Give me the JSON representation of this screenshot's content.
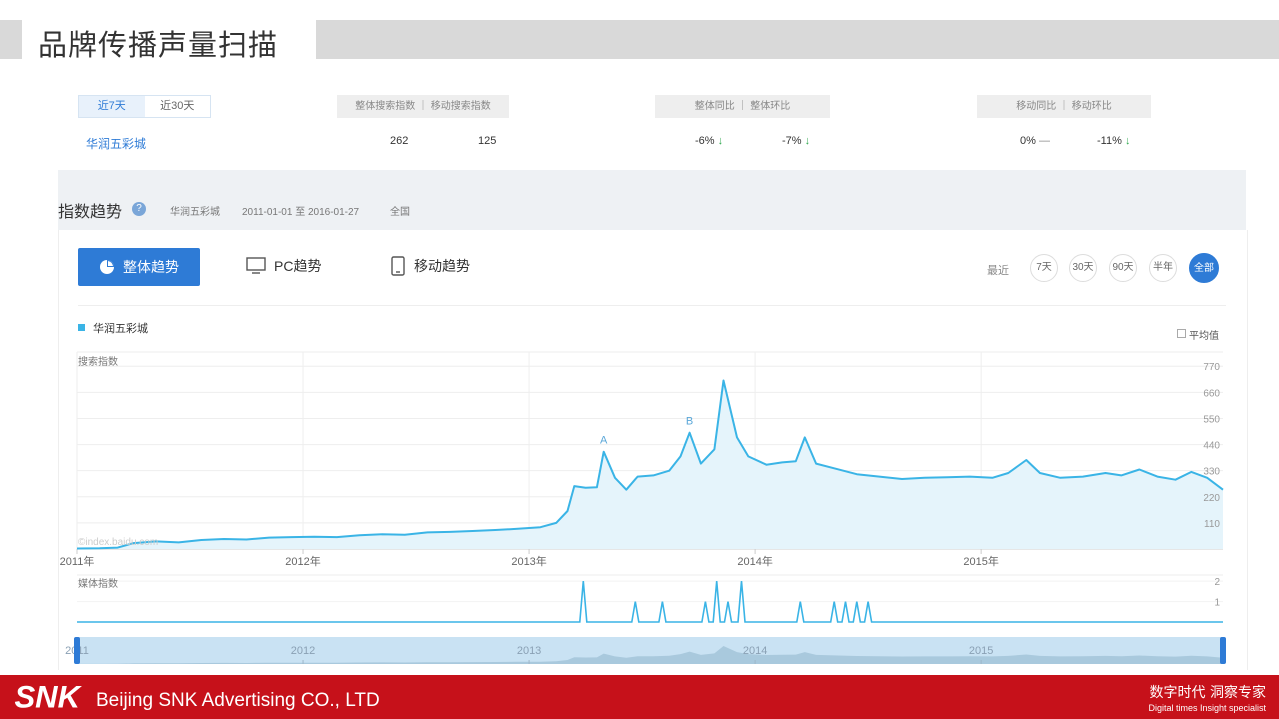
{
  "slide": {
    "title": "品牌传播声量扫描"
  },
  "summary": {
    "tabs": [
      {
        "label": "近7天",
        "active": true
      },
      {
        "label": "近30天",
        "active": false
      }
    ],
    "groups": [
      {
        "header": "整体搜索指数 ｜ 移动搜索指数"
      },
      {
        "header": "整体同比 ｜ 整体环比"
      },
      {
        "header": "移动同比 ｜ 移动环比"
      }
    ],
    "brand": "华润五彩城",
    "values": {
      "overall_search": "262",
      "mobile_search": "125",
      "overall_yoy": "-6%",
      "overall_mom": "-7%",
      "mobile_yoy": "0%",
      "mobile_yoy_flat": "—",
      "mobile_mom": "-11%"
    },
    "arrow_down": "↓"
  },
  "index_trend": {
    "title": "指数趋势",
    "help": "?",
    "brand": "华润五彩城",
    "date_range": "2011-01-01 至 2016-01-27",
    "region": "全国"
  },
  "view_tabs": {
    "overall": "整体趋势",
    "pc": "PC趋势",
    "mobile": "移动趋势"
  },
  "range": {
    "label": "最近",
    "options": [
      {
        "label": "7天",
        "active": false
      },
      {
        "label": "30天",
        "active": false
      },
      {
        "label": "90天",
        "active": false
      },
      {
        "label": "半年",
        "active": false
      },
      {
        "label": "全部",
        "active": true
      }
    ]
  },
  "legend": {
    "series": "华润五彩城",
    "average": "平均值"
  },
  "chart_data": [
    {
      "type": "area",
      "ylabel": "搜索指数",
      "yticks": [
        110,
        220,
        330,
        440,
        550,
        660,
        770
      ],
      "ylim": [
        0,
        830
      ],
      "x_ticks": [
        "2011年",
        "2012年",
        "2013年",
        "2014年",
        "2015年"
      ],
      "xlim": [
        2011.0,
        2016.07
      ],
      "watermark": "©index.baidu.com",
      "color": "#3ab4e6",
      "fill": "#e5f4fb",
      "annotations": [
        {
          "label": "A",
          "x": 2013.33
        },
        {
          "label": "B",
          "x": 2013.71
        }
      ],
      "series": [
        {
          "name": "华润五彩城",
          "points": [
            [
              2011.0,
              2
            ],
            [
              2011.1,
              3
            ],
            [
              2011.18,
              6
            ],
            [
              2011.25,
              25
            ],
            [
              2011.35,
              32
            ],
            [
              2011.45,
              28
            ],
            [
              2011.55,
              38
            ],
            [
              2011.65,
              42
            ],
            [
              2011.75,
              40
            ],
            [
              2011.85,
              48
            ],
            [
              2011.95,
              50
            ],
            [
              2012.05,
              52
            ],
            [
              2012.15,
              50
            ],
            [
              2012.25,
              58
            ],
            [
              2012.35,
              62
            ],
            [
              2012.45,
              60
            ],
            [
              2012.55,
              70
            ],
            [
              2012.65,
              72
            ],
            [
              2012.75,
              76
            ],
            [
              2012.85,
              80
            ],
            [
              2012.95,
              85
            ],
            [
              2013.05,
              92
            ],
            [
              2013.12,
              110
            ],
            [
              2013.17,
              160
            ],
            [
              2013.2,
              265
            ],
            [
              2013.25,
              258
            ],
            [
              2013.3,
              260
            ],
            [
              2013.33,
              410
            ],
            [
              2013.38,
              300
            ],
            [
              2013.43,
              250
            ],
            [
              2013.48,
              305
            ],
            [
              2013.55,
              310
            ],
            [
              2013.62,
              330
            ],
            [
              2013.67,
              390
            ],
            [
              2013.71,
              490
            ],
            [
              2013.76,
              360
            ],
            [
              2013.82,
              420
            ],
            [
              2013.86,
              710
            ],
            [
              2013.92,
              470
            ],
            [
              2013.97,
              390
            ],
            [
              2014.05,
              355
            ],
            [
              2014.12,
              365
            ],
            [
              2014.18,
              370
            ],
            [
              2014.22,
              470
            ],
            [
              2014.27,
              360
            ],
            [
              2014.35,
              340
            ],
            [
              2014.45,
              315
            ],
            [
              2014.55,
              305
            ],
            [
              2014.65,
              295
            ],
            [
              2014.75,
              300
            ],
            [
              2014.85,
              302
            ],
            [
              2014.95,
              305
            ],
            [
              2015.05,
              300
            ],
            [
              2015.12,
              320
            ],
            [
              2015.2,
              375
            ],
            [
              2015.26,
              320
            ],
            [
              2015.35,
              300
            ],
            [
              2015.45,
              305
            ],
            [
              2015.55,
              320
            ],
            [
              2015.62,
              310
            ],
            [
              2015.7,
              335
            ],
            [
              2015.78,
              305
            ],
            [
              2015.86,
              292
            ],
            [
              2015.93,
              325
            ],
            [
              2016.0,
              300
            ],
            [
              2016.07,
              250
            ]
          ]
        }
      ]
    },
    {
      "type": "line",
      "ylabel": "媒体指数",
      "yticks": [
        1,
        2
      ],
      "ylim": [
        0,
        2.3
      ],
      "color": "#3ab4e6",
      "series": [
        {
          "name": "华润五彩城",
          "x": [
            2013.24,
            2013.47,
            2013.59,
            2013.78,
            2013.83,
            2013.88,
            2013.94,
            2014.2,
            2014.35,
            2014.4,
            2014.45,
            2014.5
          ],
          "values": [
            2,
            1,
            1,
            1,
            2,
            1,
            2,
            1,
            1,
            1,
            1,
            1
          ]
        }
      ]
    },
    {
      "type": "area",
      "x_ticks": [
        "2011",
        "2012",
        "2013",
        "2014",
        "2015"
      ],
      "xlim": [
        2011.0,
        2016.07
      ]
    }
  ],
  "footer": {
    "logo": "SNK",
    "company": "Beijing SNK Advertising CO., LTD",
    "slogan_cn": "数字时代 洞察专家",
    "slogan_en": "Digital times Insight specialist"
  }
}
